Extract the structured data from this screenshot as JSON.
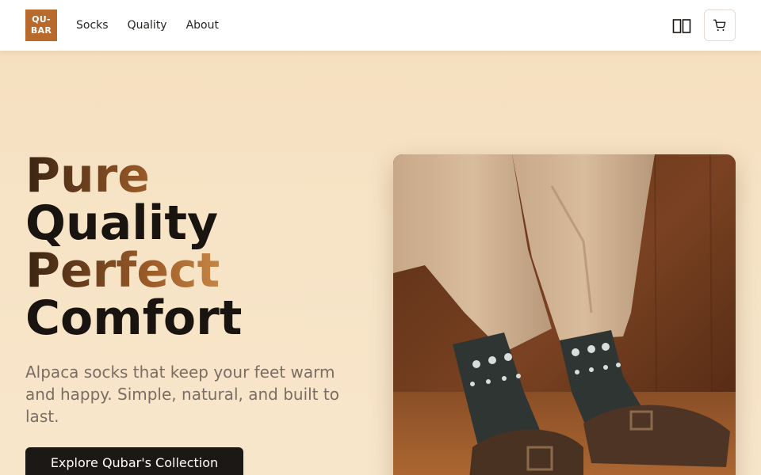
{
  "brand": {
    "logo_line1": "QU-",
    "logo_line2": "BAR",
    "color": "#b86a2c"
  },
  "nav": {
    "items": [
      {
        "label": "Socks"
      },
      {
        "label": "Quality"
      },
      {
        "label": "About"
      }
    ]
  },
  "header_actions": {
    "panel_icon": "book-open-icon",
    "cart_icon": "shopping-cart-icon"
  },
  "hero": {
    "headline": {
      "line1": "Pure",
      "line2": "Quality",
      "line3": "Perfect",
      "line4": "Comfort"
    },
    "subtitle": "Alpaca socks that keep your feet warm and happy. Simple, natural, and built to last.",
    "cta_label": "Explore Qubar's Collection",
    "accent_gradient": [
      "#3a2412",
      "#9a5a28",
      "#c58443",
      "#6a4020"
    ]
  },
  "colors": {
    "background": "#f7e4c6",
    "text_dark": "#1a1410",
    "text_muted": "#7a6e64",
    "cta_bg": "#1c1816"
  }
}
